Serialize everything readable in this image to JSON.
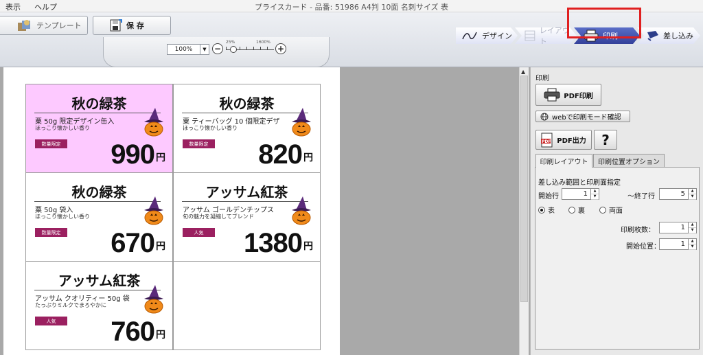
{
  "menu": {
    "items": [
      "表示",
      "ヘルプ"
    ]
  },
  "window_title": "プライスカード - 品番: 51986 A4判 10面 名刺サイズ 表",
  "toolbar": {
    "template_label": "テンプレート",
    "save_label": "保 存"
  },
  "zoom": {
    "value": "100%",
    "tick_min": "25%",
    "tick_max": "1600%",
    "slider_fraction": 0.1
  },
  "steps": [
    {
      "label": "デザイン",
      "icon": "pen-icon"
    },
    {
      "label": "レイアウト",
      "icon": "layout-icon"
    },
    {
      "label": "印刷",
      "icon": "printer-icon"
    },
    {
      "label": "差し込み",
      "icon": "insert-icon"
    }
  ],
  "active_step": "印刷",
  "cards": [
    {
      "title": "秋の緑茶",
      "desc": "粟 50g 限定デザイン缶入",
      "sub": "ほっこり懐かしい香り",
      "badge": "数量限定",
      "price": "990",
      "yen": "円",
      "bg": "#fdc9ff"
    },
    {
      "title": "秋の緑茶",
      "desc": "粟 ティーバッグ 10 個限定デザ",
      "sub": "ほっこり懐かしい香り",
      "badge": "数量限定",
      "price": "820",
      "yen": "円",
      "bg": "#ffffff"
    },
    {
      "title": "秋の緑茶",
      "desc": "粟 50g 袋入",
      "sub": "ほっこり懐かしい香り",
      "badge": "数量限定",
      "price": "670",
      "yen": "円",
      "bg": "#ffffff"
    },
    {
      "title": "アッサム紅茶",
      "desc": "アッサム ゴールデンチップス",
      "sub": "旬の魅力を凝縮してブレンド",
      "badge": "人気",
      "price": "1380",
      "yen": "円",
      "bg": "#ffffff"
    },
    {
      "title": "アッサム紅茶",
      "desc": "アッサム クオリティー 50g 袋",
      "sub": "たっぷりミルクでまろやかに",
      "badge": "人気",
      "price": "760",
      "yen": "円",
      "bg": "#ffffff"
    },
    {
      "title": "",
      "desc": "",
      "sub": "",
      "badge": "",
      "price": "",
      "yen": "",
      "bg": "#ffffff"
    }
  ],
  "panel": {
    "title": "印刷",
    "pdf_print_label": "PDF印刷",
    "web_check_label": "webで印刷モード確認",
    "pdf_output_label": "PDF出力",
    "help_label": "?",
    "tabs": [
      "印刷レイアウト",
      "印刷位置オプション"
    ],
    "range_heading": "差し込み範囲と印刷面指定",
    "start_row_label": "開始行",
    "start_row_value": "1",
    "end_row_label": "～終了行",
    "end_row_value": "5",
    "sides": [
      "表",
      "裏",
      "両面"
    ],
    "selected_side": "表",
    "copies_label": "印刷枚数：",
    "copies_value": "1",
    "start_pos_label": "開始位置：",
    "start_pos_value": "1"
  }
}
